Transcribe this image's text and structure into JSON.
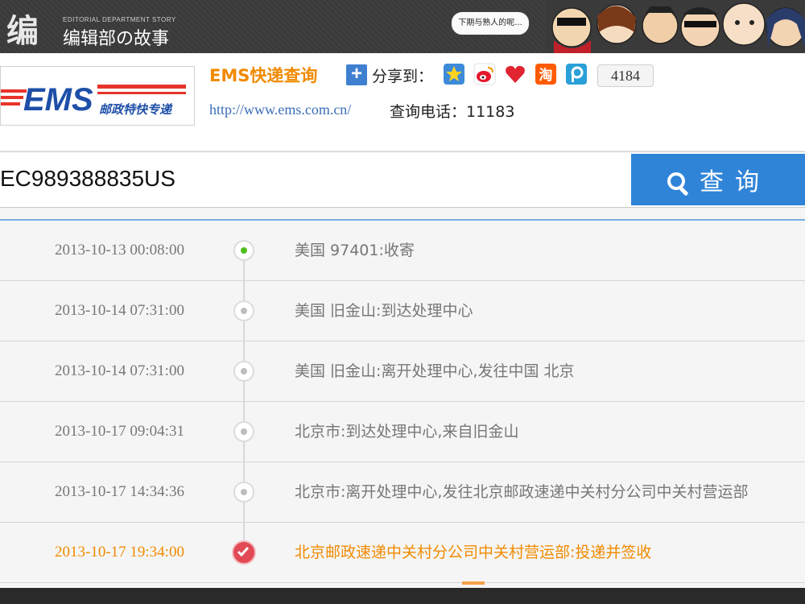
{
  "banner": {
    "brand_mark": "编",
    "brand_sub": "EDITORIAL DEPARTMENT STORY",
    "brand_name": "编辑部の故事",
    "speech": "下期与熟人的呢..."
  },
  "site": {
    "logo_text": "EMS",
    "logo_sub": "邮政特快专递",
    "title": "EMS快递查询",
    "share_label": "分享到：",
    "share_count": "4184",
    "url": "http://www.ems.com.cn/",
    "phone": "查询电话：11183"
  },
  "search": {
    "tracking_number": "EC989388835US",
    "button_label": "查询"
  },
  "tracking": [
    {
      "time": "2013-10-13 00:08:00",
      "desc": "美国 97401:收寄",
      "status": "start"
    },
    {
      "time": "2013-10-14 07:31:00",
      "desc": "美国 旧金山:到达处理中心",
      "status": "transit"
    },
    {
      "time": "2013-10-14 07:31:00",
      "desc": "美国 旧金山:离开处理中心,发往中国 北京",
      "status": "transit"
    },
    {
      "time": "2013-10-17 09:04:31",
      "desc": "北京市:到达处理中心,来自旧金山",
      "status": "transit"
    },
    {
      "time": "2013-10-17 14:34:36",
      "desc": "北京市:离开处理中心,发往北京邮政速递中关村分公司中关村营运部",
      "status": "transit"
    },
    {
      "time": "2013-10-17 19:34:00",
      "desc": "北京邮政速递中关村分公司中关村营运部:投递并签收",
      "status": "delivered"
    }
  ],
  "colors": {
    "accent": "#f08a00",
    "button": "#2f84d8",
    "link": "#3c6db8",
    "ems_red": "#e8332a",
    "ems_blue": "#1e4fa8"
  },
  "icons": {
    "share": [
      "qzone-icon",
      "weibo-icon",
      "heart-icon",
      "taobao-icon",
      "pengyou-icon"
    ]
  }
}
